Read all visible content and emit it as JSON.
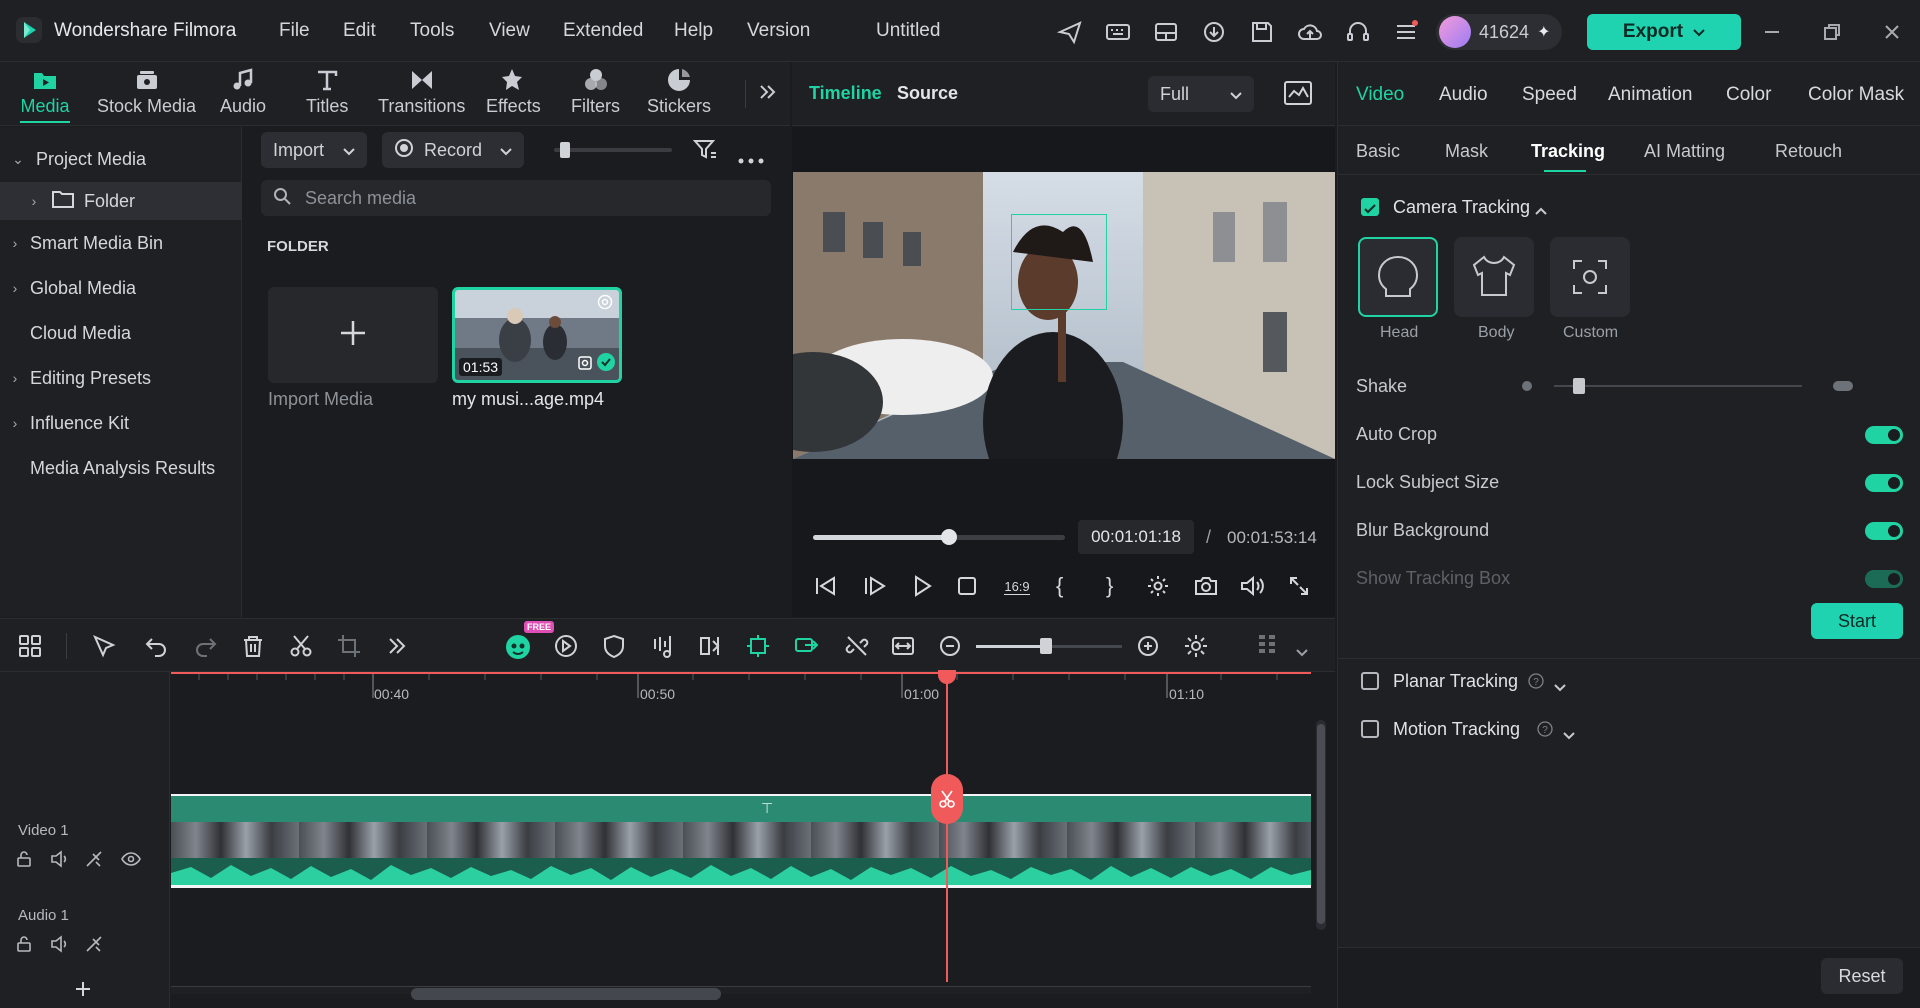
{
  "app": {
    "name": "Wondershare Filmora",
    "project_title": "Untitled",
    "user_count": "41624"
  },
  "menu": [
    "File",
    "Edit",
    "Tools",
    "View",
    "Extended",
    "Help",
    "Version"
  ],
  "export_label": "Export",
  "left_tabs": [
    "Media",
    "Stock Media",
    "Audio",
    "Titles",
    "Transitions",
    "Effects",
    "Filters",
    "Stickers"
  ],
  "sidebar": {
    "items": [
      {
        "label": "Project Media",
        "expanded": true
      },
      {
        "label": "Folder"
      },
      {
        "label": "Smart Media Bin"
      },
      {
        "label": "Global Media"
      },
      {
        "label": "Cloud Media"
      },
      {
        "label": "Editing Presets"
      },
      {
        "label": "Influence Kit"
      },
      {
        "label": "Media Analysis Results"
      }
    ]
  },
  "media": {
    "import_label": "Import",
    "record_label": "Record",
    "search_placeholder": "Search media",
    "folder_heading": "FOLDER",
    "import_media_label": "Import Media",
    "clip_name": "my musi...age.mp4",
    "clip_duration": "01:53"
  },
  "player": {
    "tab_timeline": "Timeline",
    "tab_source": "Source",
    "zoom_select": "Full",
    "current_time": "00:01:01:18",
    "separator": "/",
    "total_time": "00:01:53:14",
    "aspect_label": "16:9",
    "progress": 0.54
  },
  "right_panel": {
    "tabs": [
      "Video",
      "Audio",
      "Speed",
      "Animation",
      "Color",
      "Color Mask"
    ],
    "subtabs": [
      "Basic",
      "Mask",
      "Tracking",
      "AI Matting",
      "Retouch"
    ],
    "camera_tracking": "Camera Tracking",
    "modes": [
      "Head",
      "Body",
      "Custom"
    ],
    "shake_label": "Shake",
    "shake_level": 0.1,
    "toggles": [
      {
        "label": "Auto Crop",
        "on": true
      },
      {
        "label": "Lock Subject Size",
        "on": true
      },
      {
        "label": "Blur Background",
        "on": true
      },
      {
        "label": "Show Tracking Box",
        "on": true,
        "disabled": true
      }
    ],
    "start_label": "Start",
    "planar_tracking": "Planar Tracking",
    "motion_tracking": "Motion Tracking",
    "reset_label": "Reset"
  },
  "timeline": {
    "ruler": [
      "00:40",
      "00:50",
      "01:00",
      "01:10"
    ],
    "badge_free": "FREE",
    "tracks": [
      "Video 1",
      "Audio 1"
    ]
  },
  "colors": {
    "accent": "#1fd3a3",
    "playhead": "#f05a5a",
    "export": "#1fd3b0"
  }
}
